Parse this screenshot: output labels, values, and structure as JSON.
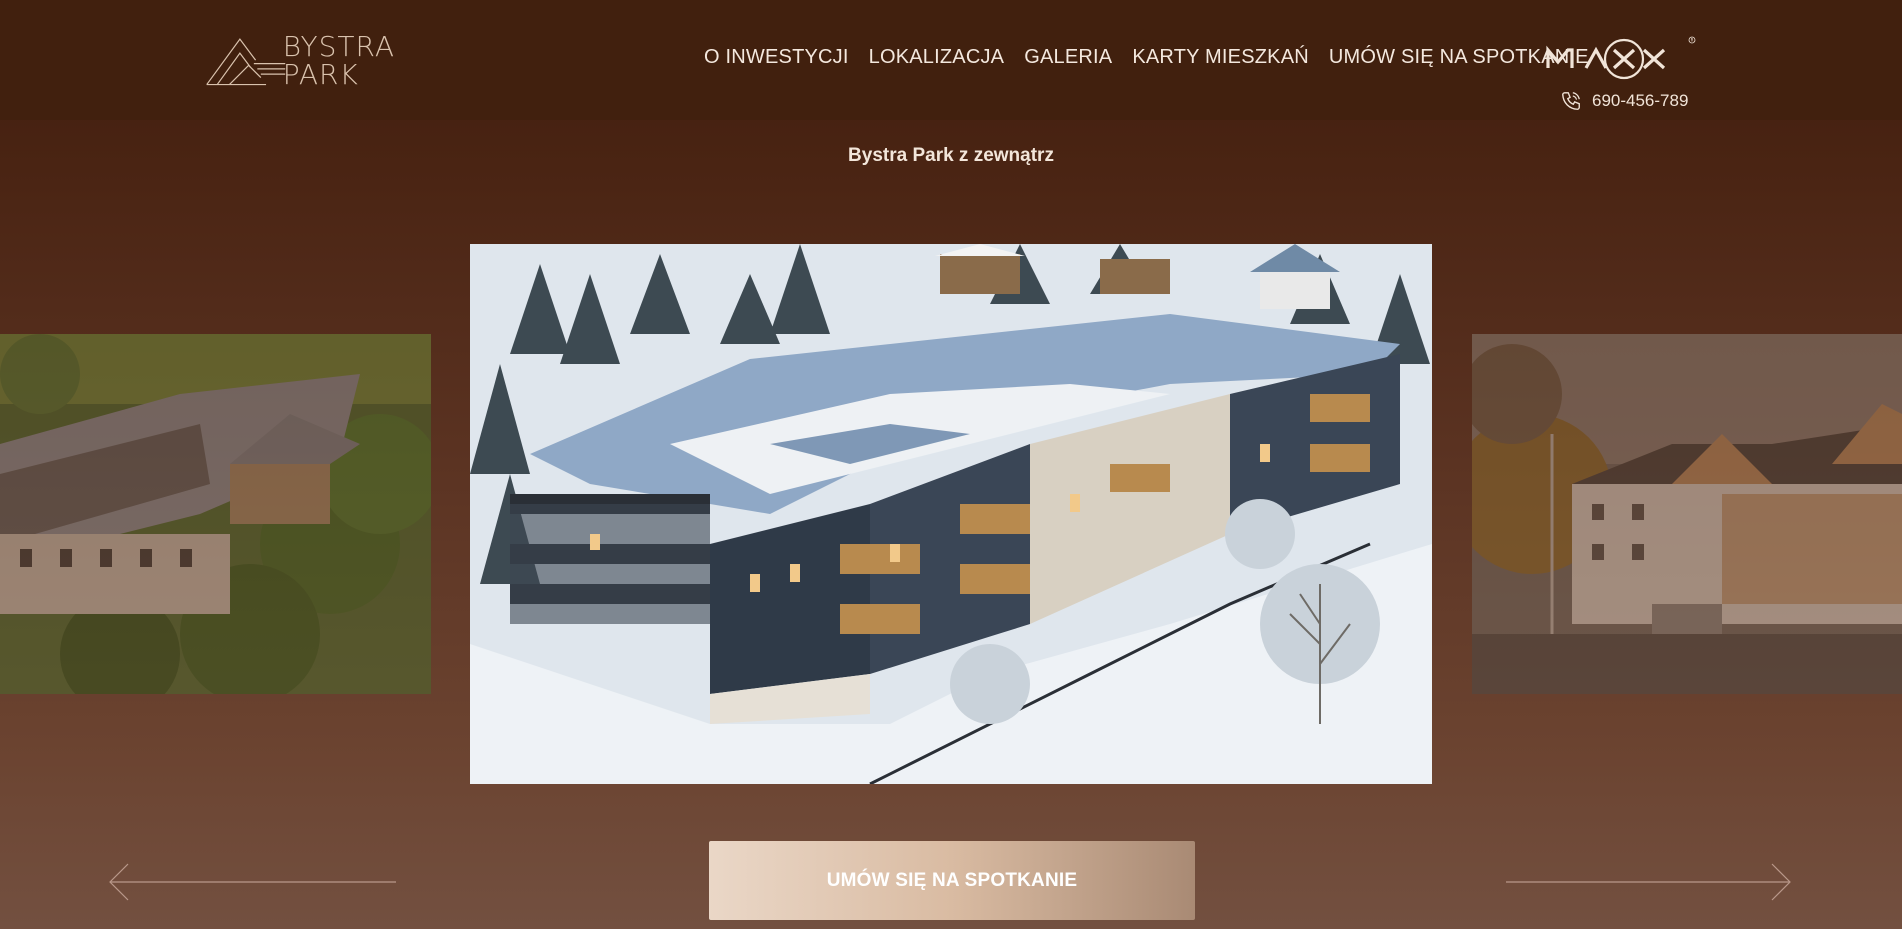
{
  "brand": {
    "logo_line1": "BYSTRA",
    "logo_line2": "PARK",
    "developer_logo": "MAXX"
  },
  "nav": {
    "items": [
      {
        "label": "O INWESTYCJI"
      },
      {
        "label": "LOKALIZACJA"
      },
      {
        "label": "GALERIA"
      },
      {
        "label": "KARTY MIESZKAŃ"
      },
      {
        "label": "UMÓW SIĘ NA SPOTKANIE"
      }
    ]
  },
  "contact": {
    "phone": "690-456-789",
    "icon": "phone-icon"
  },
  "gallery": {
    "title": "Bystra Park z zewnątrz",
    "cta_label": "UMÓW SIĘ NA SPOTKANIE",
    "prev_icon": "arrow-left-icon",
    "next_icon": "arrow-right-icon",
    "slides": [
      {
        "name": "summer-aerial-render"
      },
      {
        "name": "winter-aerial-render"
      },
      {
        "name": "autumn-street-render"
      }
    ]
  },
  "colors": {
    "header_bg": "#41200e",
    "page_bg_top": "#4a2413",
    "page_bg_bottom": "#735040",
    "accent": "#f2dccb"
  },
  "page_progress": 0.29
}
